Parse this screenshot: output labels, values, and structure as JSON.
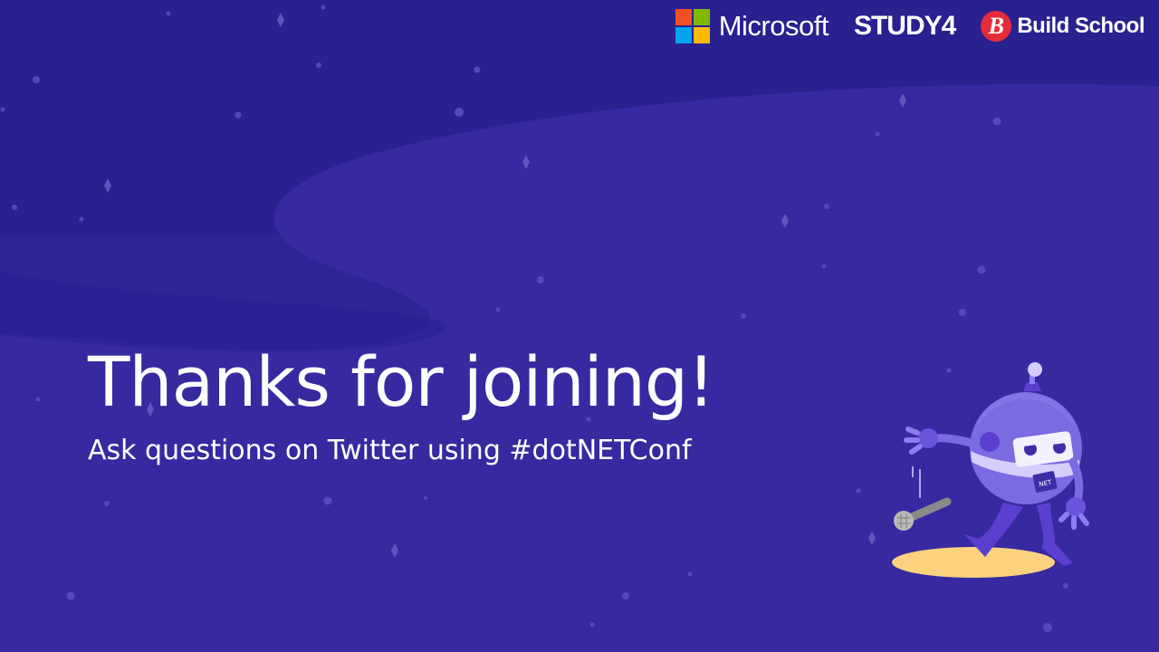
{
  "slide": {
    "title": "Thanks for joining!",
    "subtitle": "Ask questions on Twitter using #dotNETConf",
    "background_color": "#2d2496"
  },
  "logos": {
    "microsoft": "Microsoft",
    "study4": "STUDY4",
    "build_school_mark": "B",
    "build_school": "Build School"
  },
  "mascot": {
    "badge_text": "NET"
  },
  "colors": {
    "ms_red": "#f25022",
    "ms_green": "#7fba00",
    "ms_blue": "#00a4ef",
    "ms_yellow": "#ffb900",
    "build_school_red": "#e52d39",
    "stage_spot": "#fcd27e"
  }
}
